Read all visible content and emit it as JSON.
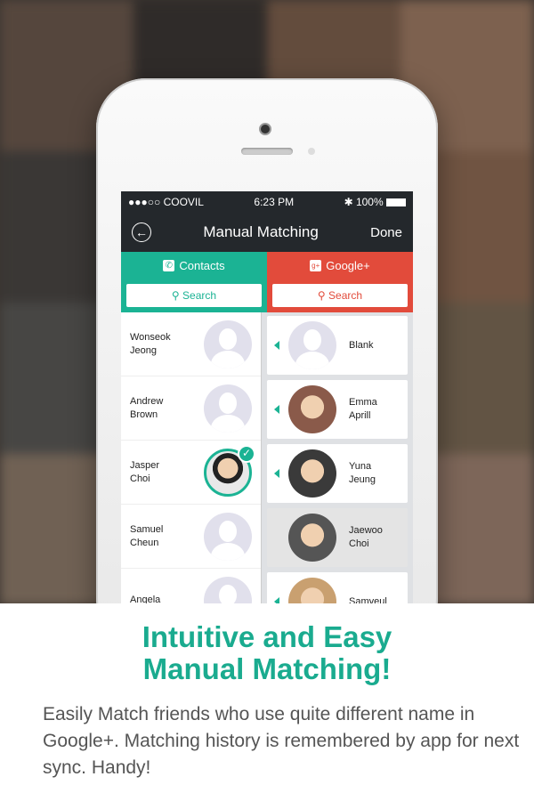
{
  "status": {
    "carrier": "●●●○○ COOVIL",
    "time": "6:23 PM",
    "battery": "100%"
  },
  "nav": {
    "title": "Manual Matching",
    "done": "Done"
  },
  "tabs": {
    "contacts": "Contacts",
    "google": "Google+",
    "search": "Search"
  },
  "colors": {
    "teal": "#1bb394",
    "red": "#e24b3b",
    "dark": "#24282c"
  },
  "contacts": [
    {
      "first": "Wonseok",
      "last": "Jeong",
      "photo": false,
      "checked": false
    },
    {
      "first": "Andrew",
      "last": "Brown",
      "photo": false,
      "checked": false
    },
    {
      "first": "Jasper",
      "last": "Choi",
      "photo": true,
      "checked": true
    },
    {
      "first": "Samuel",
      "last": "Cheun",
      "photo": false,
      "checked": false
    },
    {
      "first": "Angela",
      "last": "",
      "photo": false,
      "checked": false
    }
  ],
  "google": [
    {
      "first": "Blank",
      "last": "",
      "photo": false
    },
    {
      "first": "Emma",
      "last": "Aprill",
      "photo": true
    },
    {
      "first": "Yuna",
      "last": "Jeung",
      "photo": true
    },
    {
      "first": "Jaewoo",
      "last": "Choi",
      "photo": true,
      "selected": true
    },
    {
      "first": "Samyeul",
      "last": "",
      "photo": true
    }
  ],
  "promo": {
    "title_line1": "Intuitive and Easy",
    "title_line2": "Manual Matching!",
    "body": "Easily Match friends who use quite different name in Google+. Matching history is remembered by app for next sync. Handy!"
  }
}
